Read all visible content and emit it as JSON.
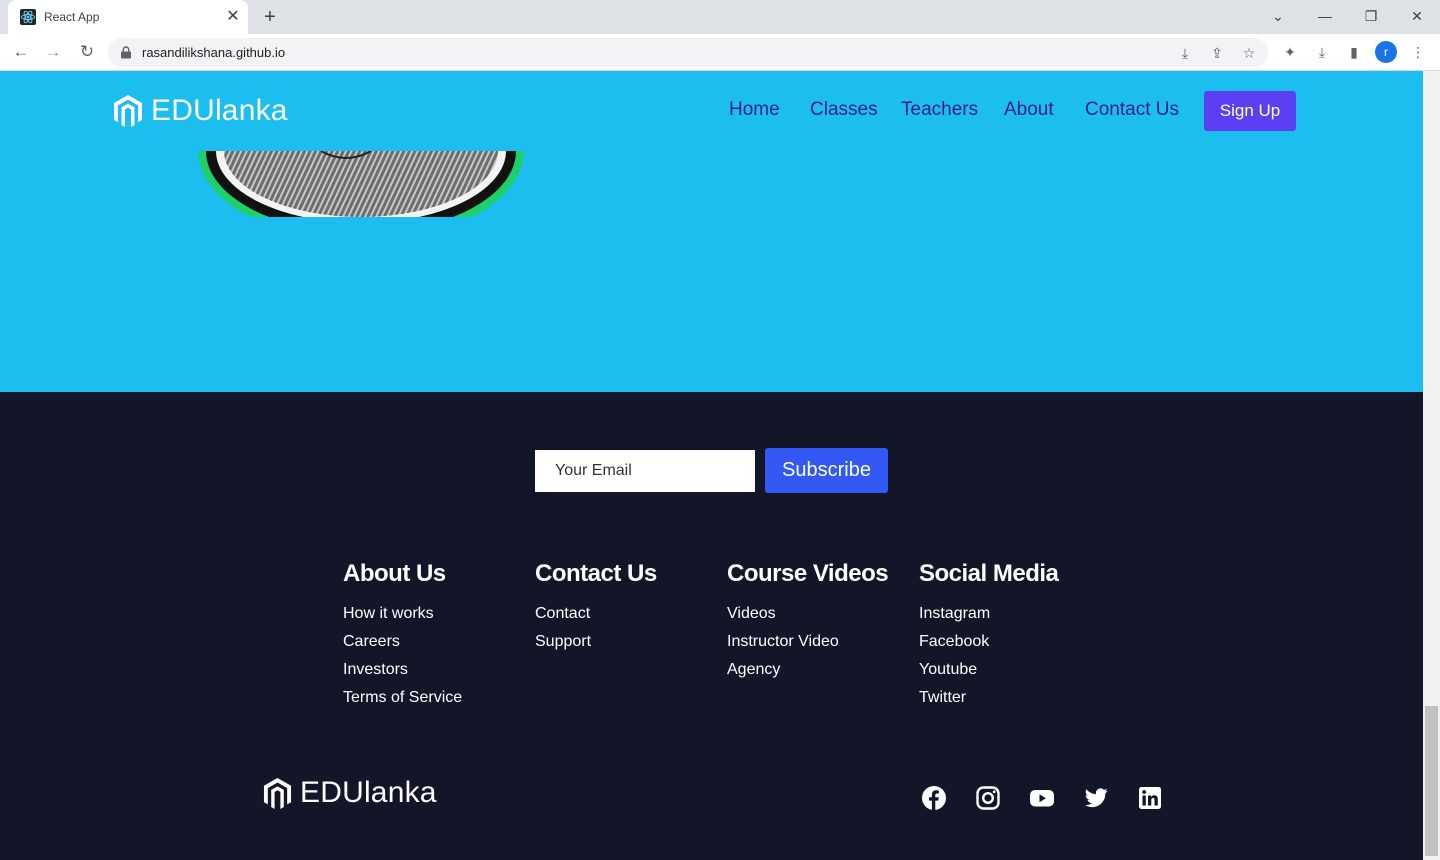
{
  "browser": {
    "tab_title": "React App",
    "url": "rasandilikshana.github.io",
    "profile_initial": "r"
  },
  "nav": {
    "brand": "EDUlanka",
    "links": [
      "Home",
      "Classes",
      "Teachers",
      "About",
      "Contact Us"
    ],
    "signup_label": "Sign Up"
  },
  "subscribe": {
    "placeholder": "Your Email",
    "button_label": "Subscribe"
  },
  "footer": {
    "columns": [
      {
        "title": "About Us",
        "links": [
          "How it works",
          "Careers",
          "Investors",
          "Terms of Service"
        ]
      },
      {
        "title": "Contact Us",
        "links": [
          "Contact",
          "Support"
        ]
      },
      {
        "title": "Course Videos",
        "links": [
          "Videos",
          "Instructor Video",
          "Agency"
        ]
      },
      {
        "title": "Social Media",
        "links": [
          "Instagram",
          "Facebook",
          "Youtube",
          "Twitter"
        ]
      }
    ],
    "brand": "EDUlanka",
    "social_icons": [
      "facebook-icon",
      "instagram-icon",
      "youtube-icon",
      "twitter-icon",
      "linkedin-icon"
    ]
  },
  "colors": {
    "hero_bg": "#1cbef0",
    "nav_link": "#2d1f8a",
    "signup_bg": "#5b3ff2",
    "footer_bg": "#121628",
    "subscribe_bg": "#3358f4"
  }
}
